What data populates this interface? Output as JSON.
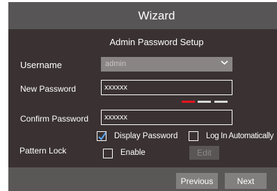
{
  "title": "Wizard",
  "section_title": "Admin Password Setup",
  "username": {
    "label": "Username",
    "value": "admin"
  },
  "new_password": {
    "label": "New Password",
    "value": "xxxxxx"
  },
  "confirm_password": {
    "label": "Confirm Password",
    "value": "xxxxxx"
  },
  "password_strength": {
    "level": 1,
    "of": 3,
    "colors": [
      "#e8141f",
      "#d9d9d9",
      "#d9d9d9"
    ]
  },
  "options": {
    "display_password": {
      "label": "Display Password",
      "checked": true
    },
    "log_in_automatically": {
      "label": "Log In Automatically",
      "checked": false
    }
  },
  "pattern_lock": {
    "label": "Pattern Lock",
    "enable_label": "Enable",
    "enabled": false,
    "edit_label": "Edit"
  },
  "footer": {
    "previous_label": "Previous",
    "next_label": "Next"
  },
  "icons": [
    "chevron-down-icon",
    "checkmark-icon"
  ],
  "colors": {
    "panel": "#3a3232",
    "titlebar": "#575555",
    "accent_check": "#5aa8ff",
    "strength_weak": "#e8141f"
  }
}
